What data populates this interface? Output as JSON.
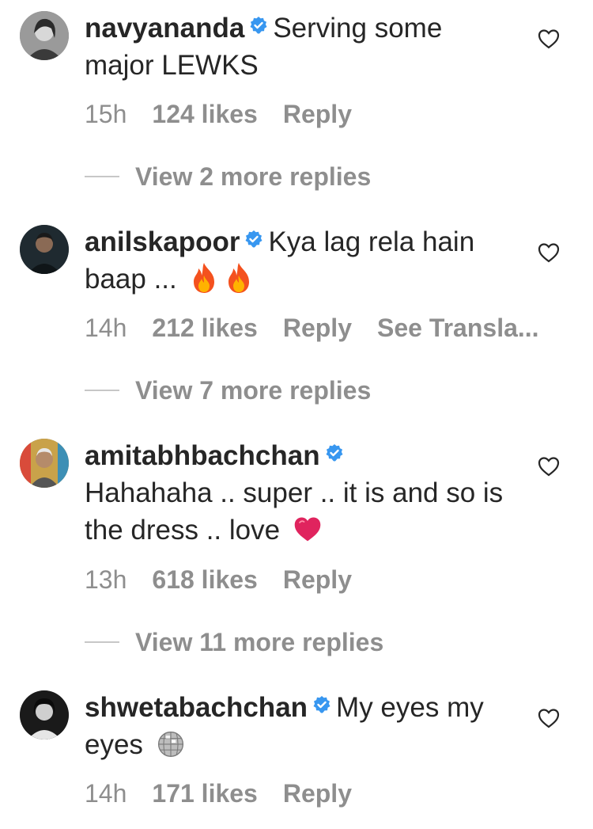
{
  "comments": [
    {
      "username": "navyananda",
      "text": "Serving some major LEWKS",
      "time": "15h",
      "likes": "124 likes",
      "reply": "Reply",
      "view_replies": "View 2 more replies"
    },
    {
      "username": "anilskapoor",
      "text": "Kya lag rela hain baap ...",
      "emoji": [
        "fire-emoji",
        "fire-emoji"
      ],
      "time": "14h",
      "likes": "212 likes",
      "reply": "Reply",
      "see_translation": "See Transla...",
      "view_replies": "View 7 more replies"
    },
    {
      "username": "amitabhbachchan",
      "text": "Hahahaha .. super .. it is and so is the dress .. love",
      "emoji": [
        "red-heart-emoji"
      ],
      "time": "13h",
      "likes": "618 likes",
      "reply": "Reply",
      "view_replies": "View 11 more replies"
    },
    {
      "username": "shwetabachchan",
      "text": "My eyes my eyes",
      "emoji": [
        "disco-ball-emoji"
      ],
      "time": "14h",
      "likes": "171 likes",
      "reply": "Reply"
    }
  ],
  "colors": {
    "text": "#262626",
    "muted": "#8e8e8e",
    "verified": "#3897f0"
  },
  "icons": [
    "verified-badge-icon",
    "heart-outline-icon"
  ]
}
